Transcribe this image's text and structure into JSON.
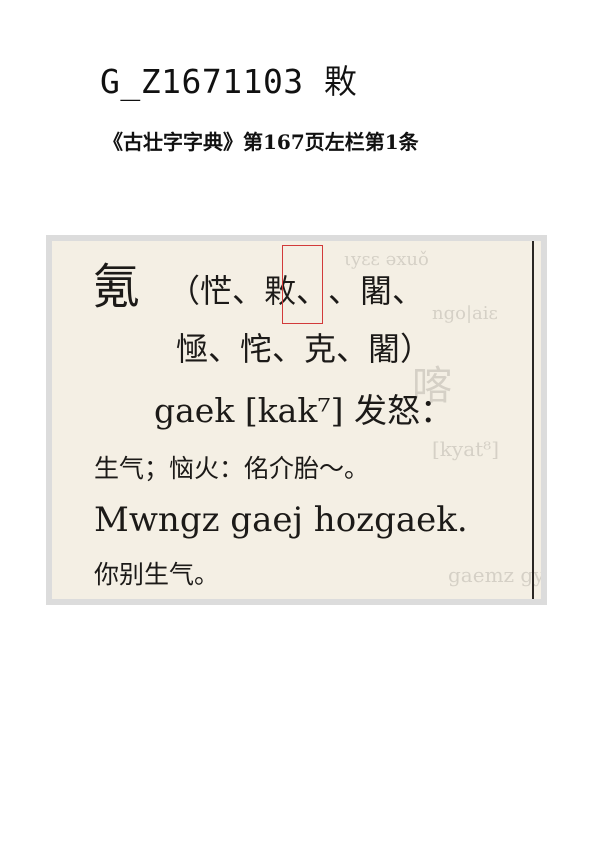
{
  "header": {
    "code": "G_Z1671103",
    "character": "㪙"
  },
  "source": {
    "citation": "《古壮字字典》第167页左栏第1条"
  },
  "scan": {
    "headword": "氪",
    "variants_line1": "（恾、㪙、𪸗、闍、",
    "variants_line2": "㥛、㤞、克、闍）",
    "romanization": "gaek [kak⁷] 发怒：",
    "gloss": "生气；恼火：佲介胎～。",
    "example": "Mwngz gaej hozgaek.",
    "translation": "你别生气。",
    "highlight_color": "#d23a3a"
  }
}
